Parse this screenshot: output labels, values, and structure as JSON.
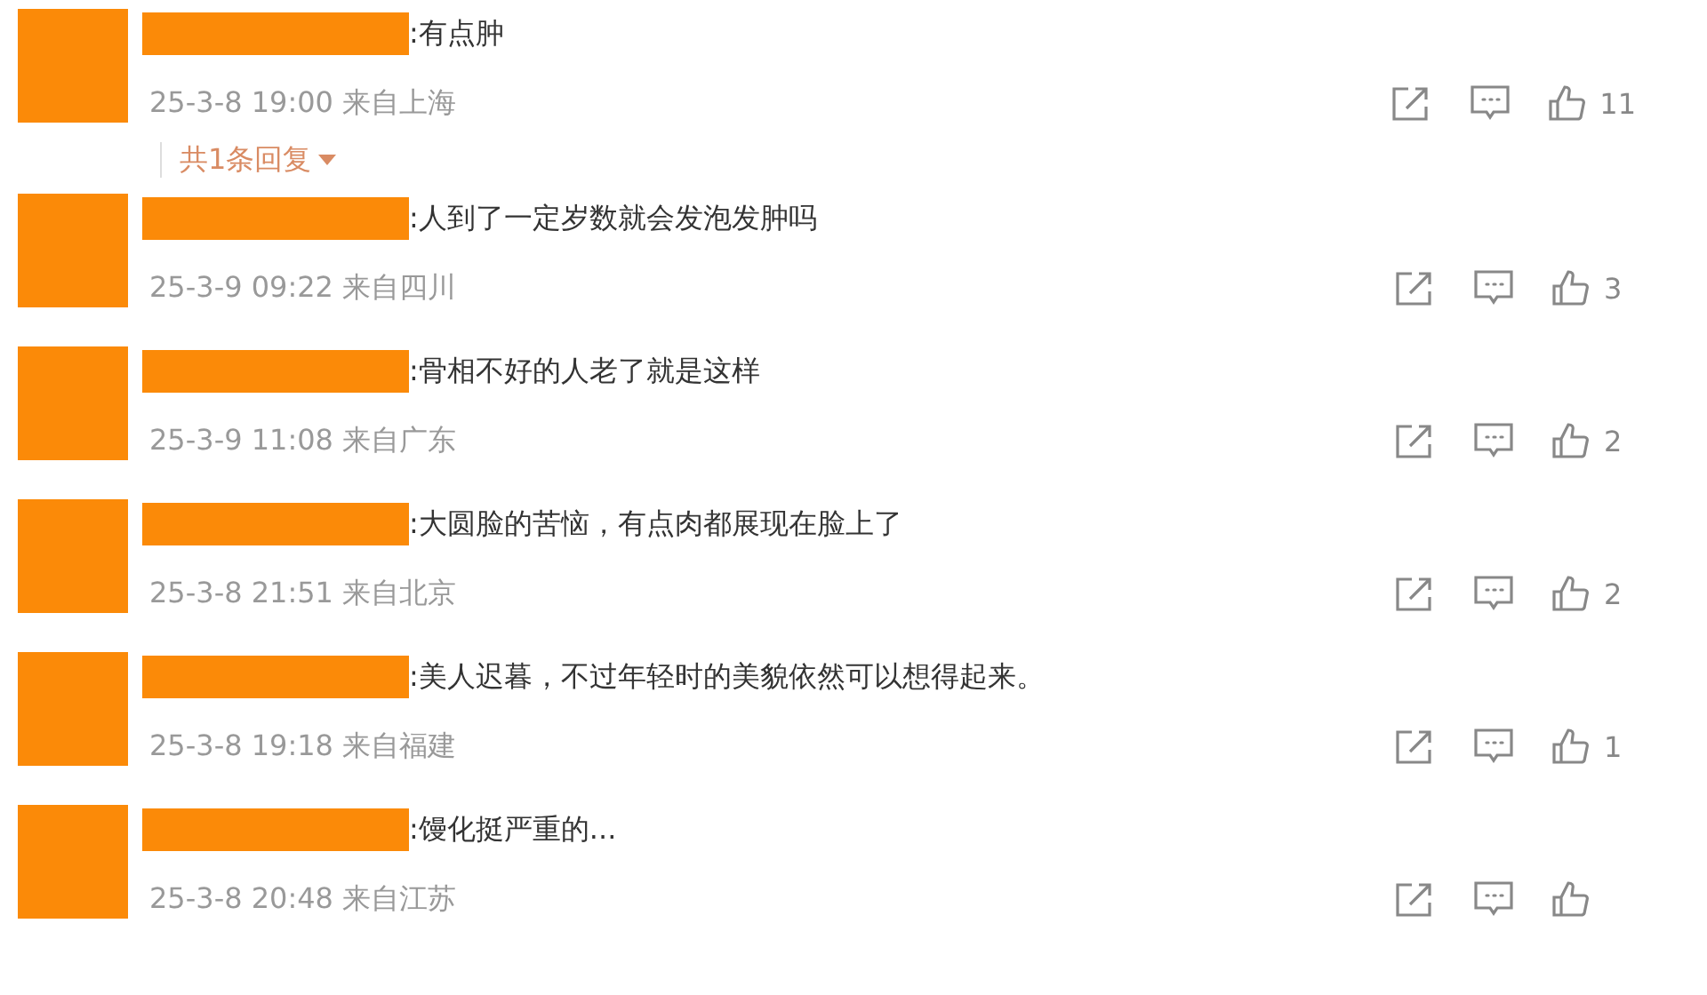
{
  "comments": [
    {
      "text": ":有点肿",
      "meta": "25-3-8 19:00 来自上海",
      "likes": "11",
      "reply_toggle": {
        "label": "共1条回复"
      }
    },
    {
      "text": ":人到了一定岁数就会发泡发肿吗",
      "meta": "25-3-9 09:22 来自四川",
      "likes": "3"
    },
    {
      "text": ":骨相不好的人老了就是这样",
      "meta": "25-3-9 11:08 来自广东",
      "likes": "2"
    },
    {
      "text": ":大圆脸的苦恼，有点肉都展现在脸上了",
      "meta": "25-3-8 21:51 来自北京",
      "likes": "2"
    },
    {
      "text": ":美人迟暮，不过年轻时的美貌依然可以想得起来。",
      "meta": "25-3-8 19:18 来自福建",
      "likes": "1"
    },
    {
      "text": ":馒化挺严重的...",
      "meta": "25-3-8 20:48 来自江苏"
    }
  ]
}
